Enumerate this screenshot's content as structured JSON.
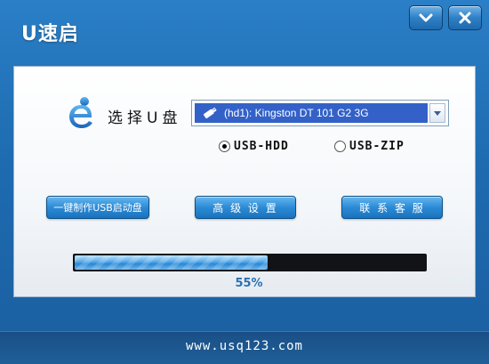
{
  "app": {
    "title": "U速启"
  },
  "window_controls": [
    {
      "name": "minimize",
      "icon": "chevron-down-icon"
    },
    {
      "name": "close",
      "icon": "close-icon"
    }
  ],
  "disk_select": {
    "label": "选择U盘",
    "selected_value": "(hd1): Kingston DT 101 G2 3G",
    "icon": "usb-drive-icon"
  },
  "mode_options": [
    {
      "label": "USB-HDD",
      "selected": true
    },
    {
      "label": "USB-ZIP",
      "selected": false
    }
  ],
  "actions": {
    "make_label": "一键制作USB启动盘",
    "advanced_label": "高 级 设 置",
    "contact_label": "联 系 客 服"
  },
  "progress": {
    "value": 0.55,
    "text": "55%"
  },
  "footer": {
    "url": "www.usq123.com"
  },
  "colors": {
    "accent": "#1e6bb0",
    "button": "#2c8bd6",
    "selection": "#3361c8",
    "progress_fill": "#5fb0ee",
    "progress_text": "#2c6fb0"
  }
}
